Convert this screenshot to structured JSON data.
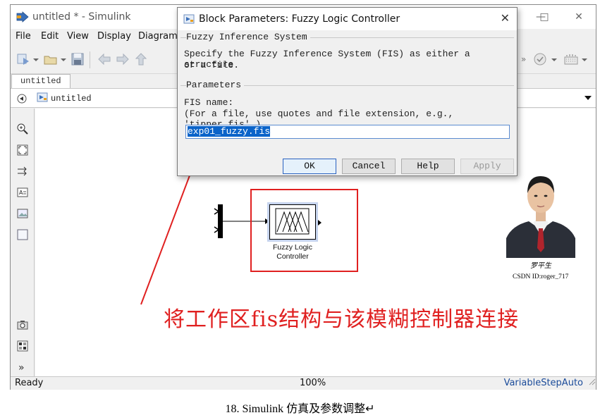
{
  "window": {
    "title": "untitled * - Simulink",
    "icons": [
      "simulink-icon",
      "minimize-icon",
      "maximize-icon",
      "close-icon"
    ]
  },
  "menu": {
    "file": "File",
    "edit": "Edit",
    "view": "View",
    "display": "Display",
    "diagram": "Diagram"
  },
  "tabs": {
    "model_tab": "untitled"
  },
  "address": {
    "crumb": "untitled"
  },
  "status": {
    "left": "Ready",
    "zoom": "100%",
    "solver": "VariableStepAuto"
  },
  "dialog": {
    "title": "Block Parameters: Fuzzy Logic Controller",
    "group1_title": "Fuzzy Inference System",
    "description_line1": "Specify the Fuzzy Inference System (FIS) as either a structure",
    "description_line2": "or a file.",
    "group2_title": "Parameters",
    "fis_label": "FIS name:",
    "fis_hint": "(For a file, use quotes and file extension, e.g., 'tipper.fis'.)",
    "fis_value": "exp01_fuzzy.fis",
    "ok": "OK",
    "cancel": "Cancel",
    "help": "Help",
    "apply": "Apply"
  },
  "block": {
    "label_line1": "Fuzzy Logic",
    "label_line2": "Controller"
  },
  "annotation": {
    "text": "将工作区fis结构与该模糊控制器连接",
    "color": "#e02020"
  },
  "author": {
    "signature": "罗平生",
    "csdn_id": "CSDN ID:roger_717"
  },
  "caption": {
    "text": "18. Simulink 仿真及参数调整↵"
  },
  "colors": {
    "accent": "#0a63c9",
    "annotation_red": "#e02020",
    "status_blue": "#1a4b9a"
  }
}
